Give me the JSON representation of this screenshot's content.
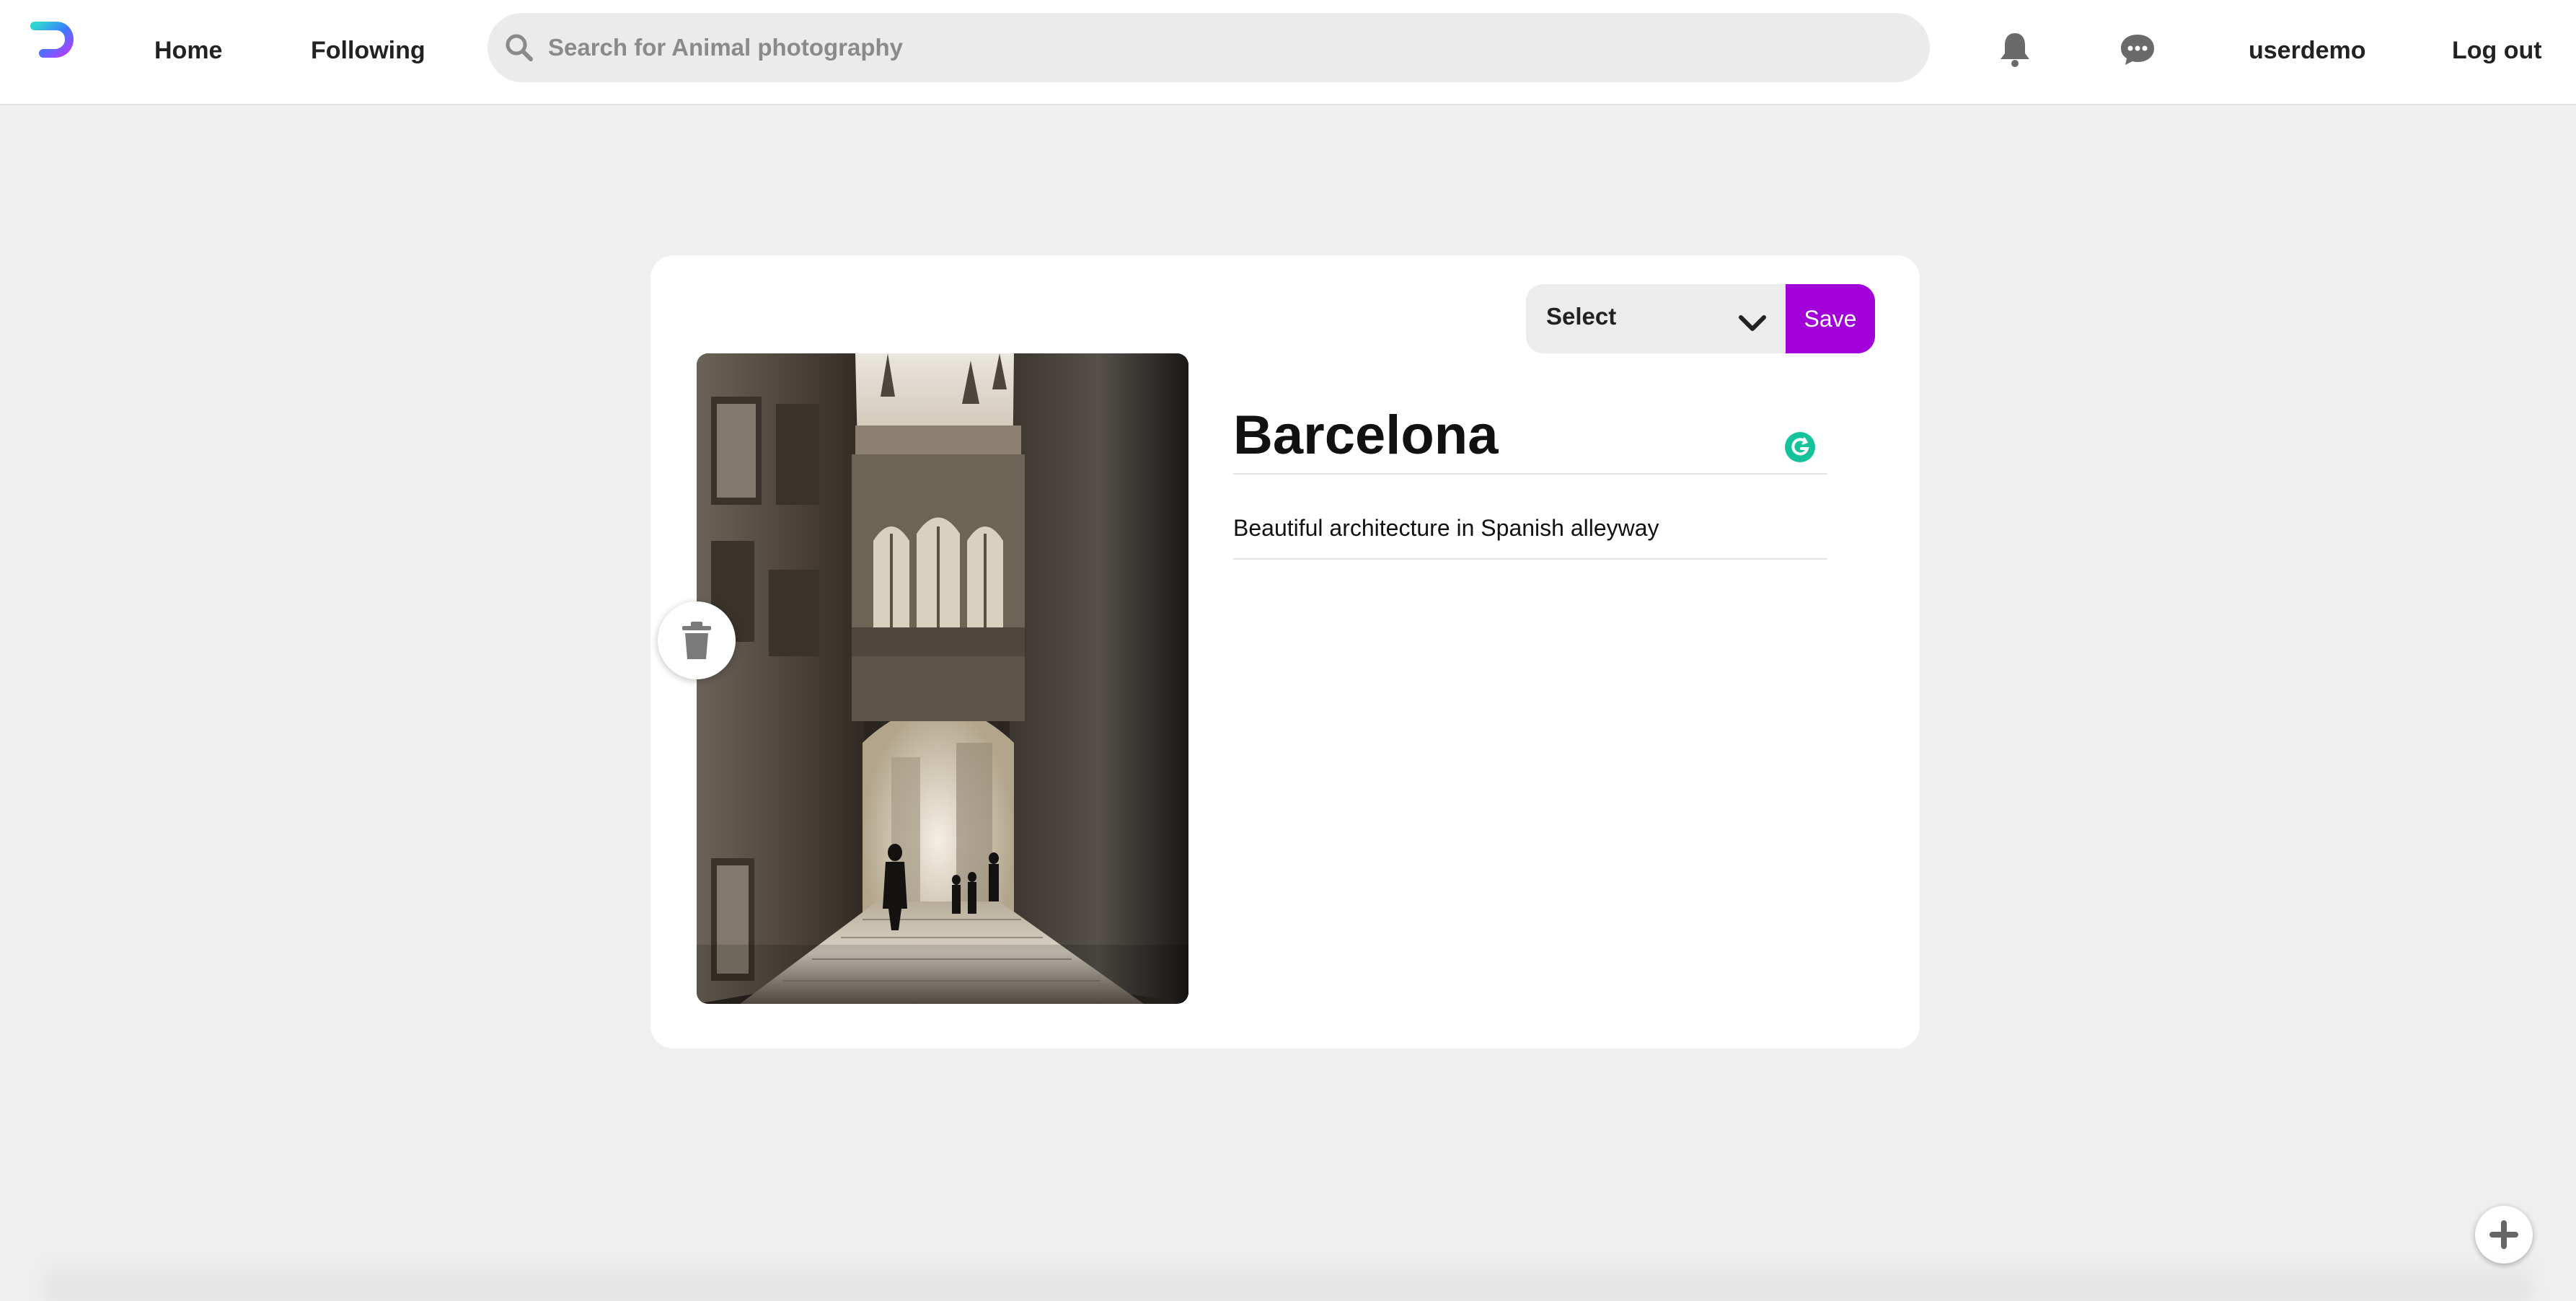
{
  "nav": {
    "home_label": "Home",
    "following_label": "Following",
    "username": "userdemo",
    "logout_label": "Log out"
  },
  "search": {
    "placeholder": "Search for Animal photography",
    "value": ""
  },
  "pin_editor": {
    "board_select": {
      "selected": "Select"
    },
    "save_label": "Save",
    "title": "Barcelona",
    "description": "Beautiful architecture in Spanish alleyway",
    "image_alt": "Gothic bridge over narrow Barcelona alleyway"
  },
  "icons": {
    "logo": "app-logo-icon",
    "search": "search-icon",
    "bell": "bell-icon",
    "chat": "chat-bubble-icon",
    "chevron": "chevron-down-icon",
    "delete": "trash-icon",
    "grammarly": "grammarly-icon",
    "add": "plus-icon"
  },
  "colors": {
    "accent": "#a100d8",
    "page_bg": "#efefef",
    "grammarly_green": "#15c39a"
  }
}
